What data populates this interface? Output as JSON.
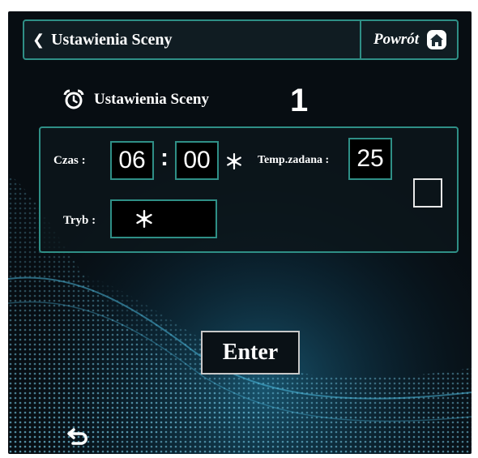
{
  "header": {
    "title": "Ustawienia Sceny",
    "back_icon": "chevron-left-icon",
    "return_label": "Powrót",
    "return_icon": "home-icon"
  },
  "scene": {
    "label": "Ustawienia Sceny",
    "icon": "alarm-clock-icon",
    "number": "1"
  },
  "settings": {
    "time_label": "Czas :",
    "hour": "06",
    "minute": "00",
    "separator": ":",
    "time_mode_icon": "snowflake-icon",
    "temp_label": "Temp.zadana :",
    "temp_value": "25",
    "mode_label": "Tryb :",
    "mode_icon": "snowflake-icon",
    "checkbox_checked": false
  },
  "actions": {
    "enter_label": "Enter",
    "undo_icon": "undo-arrow-icon"
  },
  "colors": {
    "accent": "#2f8f86",
    "background": "#070d12",
    "text": "#ffffff",
    "wave": "#3fb6e0"
  }
}
